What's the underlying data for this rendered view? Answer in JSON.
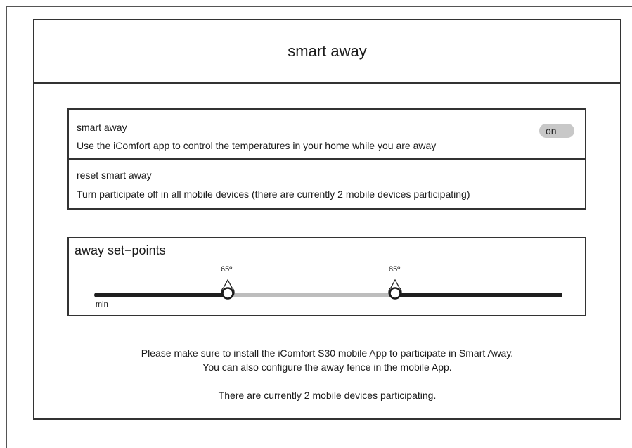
{
  "header": {
    "title": "smart away"
  },
  "smart_away": {
    "title": "smart away",
    "description": "Use the iComfort app to control the temperatures in your home while you are away",
    "toggle_label": "on"
  },
  "reset": {
    "title": "reset smart away",
    "description": "Turn participate off in all mobile devices (there are currently 2 mobile devices participating)"
  },
  "setpoints": {
    "title": "away set−points",
    "low_label": "65º",
    "high_label": "85º",
    "min_label": "min"
  },
  "info": {
    "line1": "Please make sure to install the iComfort S30 mobile App to participate in Smart Away.",
    "line2": "You can also configure the away fence in the mobile App.",
    "line3": "There are currently 2 mobile devices participating."
  }
}
